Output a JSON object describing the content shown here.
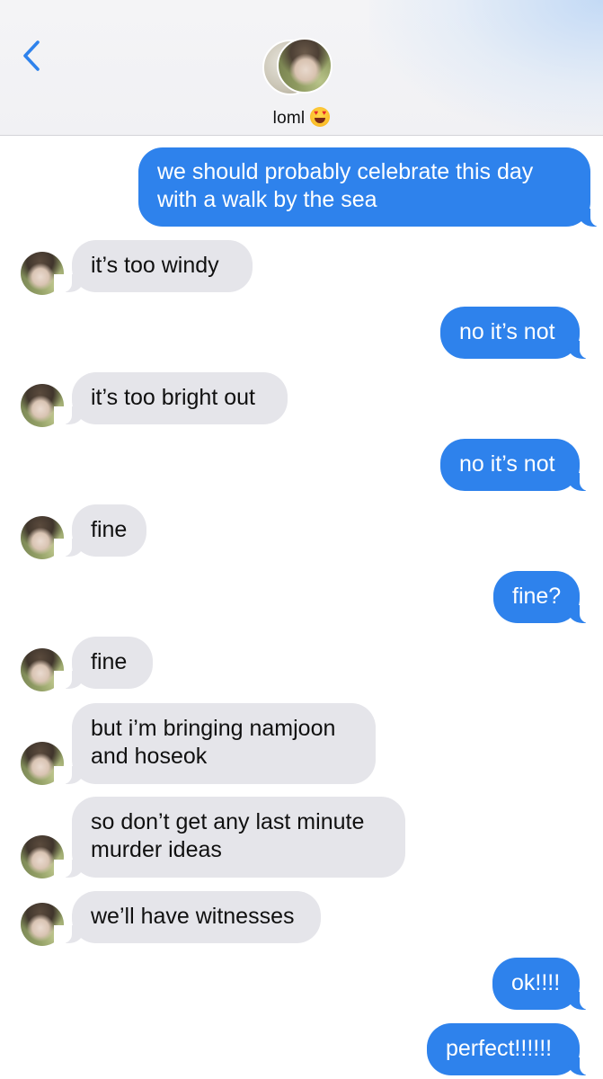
{
  "header": {
    "contact_name": "loml",
    "contact_emoji": "heart-eyes-emoji",
    "back_icon": "chevron-left-icon"
  },
  "colors": {
    "outgoing_bubble": "#2e82ec",
    "incoming_bubble": "#e5e5ea",
    "accent": "#2e82ec"
  },
  "messages": [
    {
      "direction": "outgoing",
      "lines": [
        "we should probably celebrate this day",
        "with a walk by the sea"
      ]
    },
    {
      "direction": "incoming",
      "lines": [
        "it’s too windy"
      ]
    },
    {
      "direction": "outgoing",
      "lines": [
        "no it’s not"
      ]
    },
    {
      "direction": "incoming",
      "lines": [
        "it’s too bright out"
      ]
    },
    {
      "direction": "outgoing",
      "lines": [
        "no it’s not"
      ]
    },
    {
      "direction": "incoming",
      "lines": [
        "fine"
      ]
    },
    {
      "direction": "outgoing",
      "lines": [
        "fine?"
      ]
    },
    {
      "direction": "incoming",
      "lines": [
        "fine"
      ]
    },
    {
      "direction": "incoming",
      "lines": [
        "but i’m bringing namjoon",
        "and hoseok"
      ]
    },
    {
      "direction": "incoming",
      "lines": [
        "so don’t get any last minute",
        "murder ideas"
      ]
    },
    {
      "direction": "incoming",
      "lines": [
        "we’ll have witnesses"
      ]
    },
    {
      "direction": "outgoing",
      "lines": [
        "ok!!!!"
      ]
    },
    {
      "direction": "outgoing",
      "lines": [
        "perfect!!!!!!"
      ]
    }
  ]
}
